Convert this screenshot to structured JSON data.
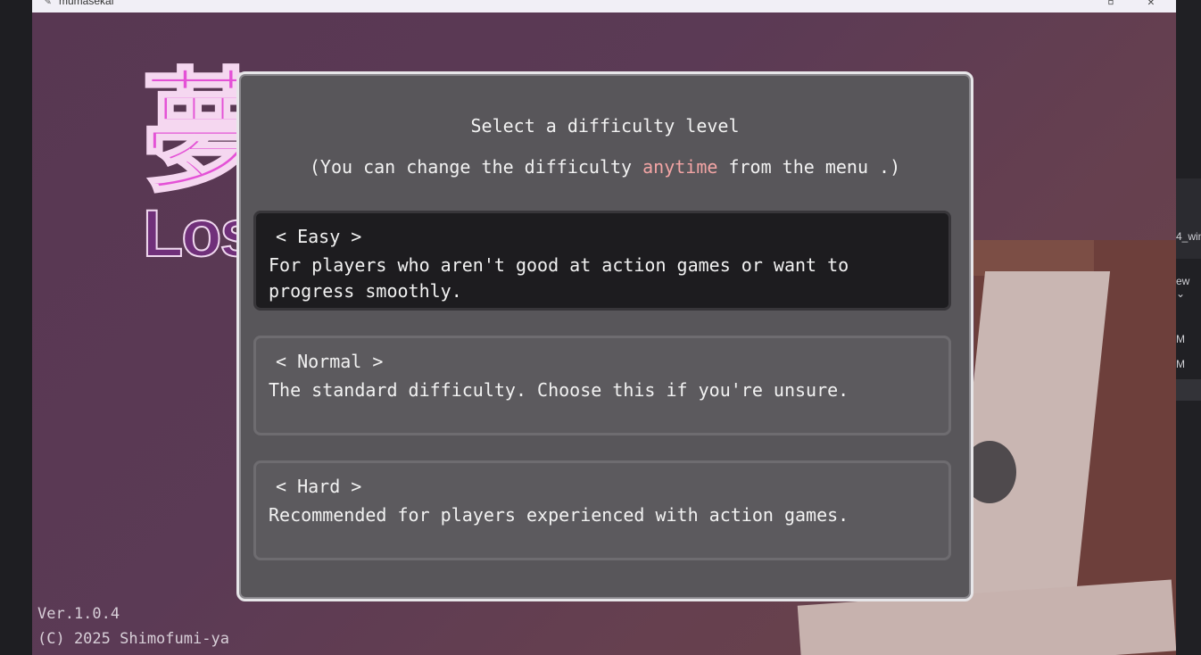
{
  "window": {
    "title": "mumasekai"
  },
  "dialog": {
    "title": "Select a difficulty level",
    "note_prefix": "(You can change the difficulty ",
    "note_highlight": "anytime",
    "note_suffix": " from the menu .)",
    "highlight_color": "#f3a5a5",
    "options": [
      {
        "name": "< Easy >",
        "description": "For players who aren't good at action games or want to progress smoothly.",
        "selected": true
      },
      {
        "name": "< Normal >",
        "description": "The standard difficulty. Choose this if you're unsure.",
        "selected": false
      },
      {
        "name": "< Hard >",
        "description": "Recommended for players experienced with action games.",
        "selected": false
      }
    ]
  },
  "logo": {
    "kanji": "夢",
    "subtitle": "Lost"
  },
  "footer": {
    "version": "Ver.1.0.4",
    "copyright": "(C) 2025 Shimofumi-ya"
  },
  "desktop_fragments": [
    "4_win",
    "ew ⌄",
    "M",
    "M"
  ],
  "colors": {
    "scene": "#583752",
    "dialog_bg": "#58565a",
    "selected_bg": "#1d1c1f",
    "text": "#f2f2f2"
  }
}
